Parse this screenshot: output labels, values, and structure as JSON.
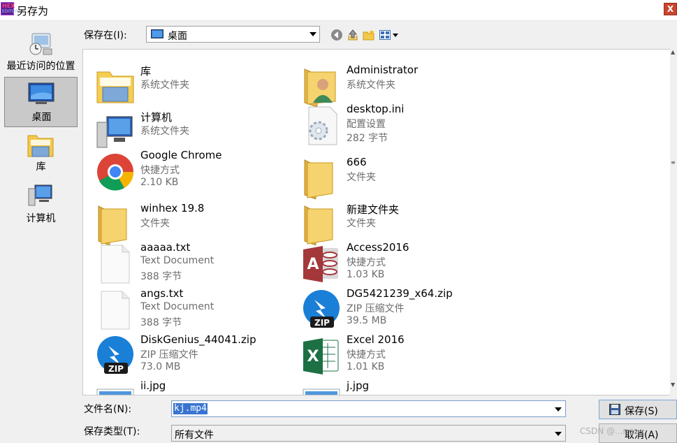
{
  "window": {
    "title": "另存为",
    "app_logo_text_top": "HEX",
    "app_logo_text_bottom": "EDITOR",
    "close_label": "X"
  },
  "places": [
    {
      "label": "最近访问的位置",
      "icon": "recent-places-icon"
    },
    {
      "label": "桌面",
      "icon": "desktop-icon",
      "selected": true
    },
    {
      "label": "库",
      "icon": "library-icon"
    },
    {
      "label": "计算机",
      "icon": "computer-icon"
    }
  ],
  "toolbar": {
    "save_in_label": "保存在(I):",
    "location": "桌面",
    "icons": [
      "back-icon",
      "up-folder-icon",
      "new-folder-icon",
      "view-menu-icon"
    ]
  },
  "files": [
    {
      "name": "库",
      "line2": "系统文件夹",
      "line3": "",
      "icon": "library-folder-icon"
    },
    {
      "name": "Administrator",
      "line2": "系统文件夹",
      "line3": "",
      "icon": "user-folder-icon"
    },
    {
      "name": "计算机",
      "line2": "系统文件夹",
      "line3": "",
      "icon": "computer-icon"
    },
    {
      "name": "desktop.ini",
      "line2": "配置设置",
      "line3": "282 字节",
      "icon": "settings-file-icon"
    },
    {
      "name": "Google Chrome",
      "line2": "快捷方式",
      "line3": "2.10 KB",
      "icon": "chrome-icon"
    },
    {
      "name": "666",
      "line2": "文件夹",
      "line3": "",
      "icon": "folder-icon"
    },
    {
      "name": "winhex 19.8",
      "line2": "文件夹",
      "line3": "",
      "icon": "folder-icon"
    },
    {
      "name": "新建文件夹",
      "line2": "文件夹",
      "line3": "",
      "icon": "folder-icon"
    },
    {
      "name": "aaaaa.txt",
      "line2": "Text Document",
      "line3": "388 字节",
      "icon": "text-document-icon"
    },
    {
      "name": "Access2016",
      "line2": "快捷方式",
      "line3": "1.03 KB",
      "icon": "access-icon"
    },
    {
      "name": "angs.txt",
      "line2": "Text Document",
      "line3": "388 字节",
      "icon": "text-document-icon"
    },
    {
      "name": "DG5421239_x64.zip",
      "line2": "ZIP 压缩文件",
      "line3": "39.5 MB",
      "icon": "diskgenius-zip-icon"
    },
    {
      "name": "DiskGenius_44041.zip",
      "line2": "ZIP 压缩文件",
      "line3": "73.0 MB",
      "icon": "diskgenius-zip-icon"
    },
    {
      "name": "Excel 2016",
      "line2": "快捷方式",
      "line3": "1.01 KB",
      "icon": "excel-icon"
    },
    {
      "name": "ii.jpg",
      "line2": "",
      "line3": "",
      "icon": "image-file-icon"
    },
    {
      "name": "j.jpg",
      "line2": "",
      "line3": "",
      "icon": "image-file-icon"
    }
  ],
  "zip_badge": "ZIP",
  "access_letter": "A",
  "excel_letter": "X",
  "bottom": {
    "filename_label": "文件名(N):",
    "filename_value": "kj.mp4",
    "filetype_label": "保存类型(T):",
    "filetype_value": "所有文件",
    "save_label": "保存(S)",
    "cancel_label": "取消(A)"
  },
  "watermark": "CSDN @...ngs"
}
